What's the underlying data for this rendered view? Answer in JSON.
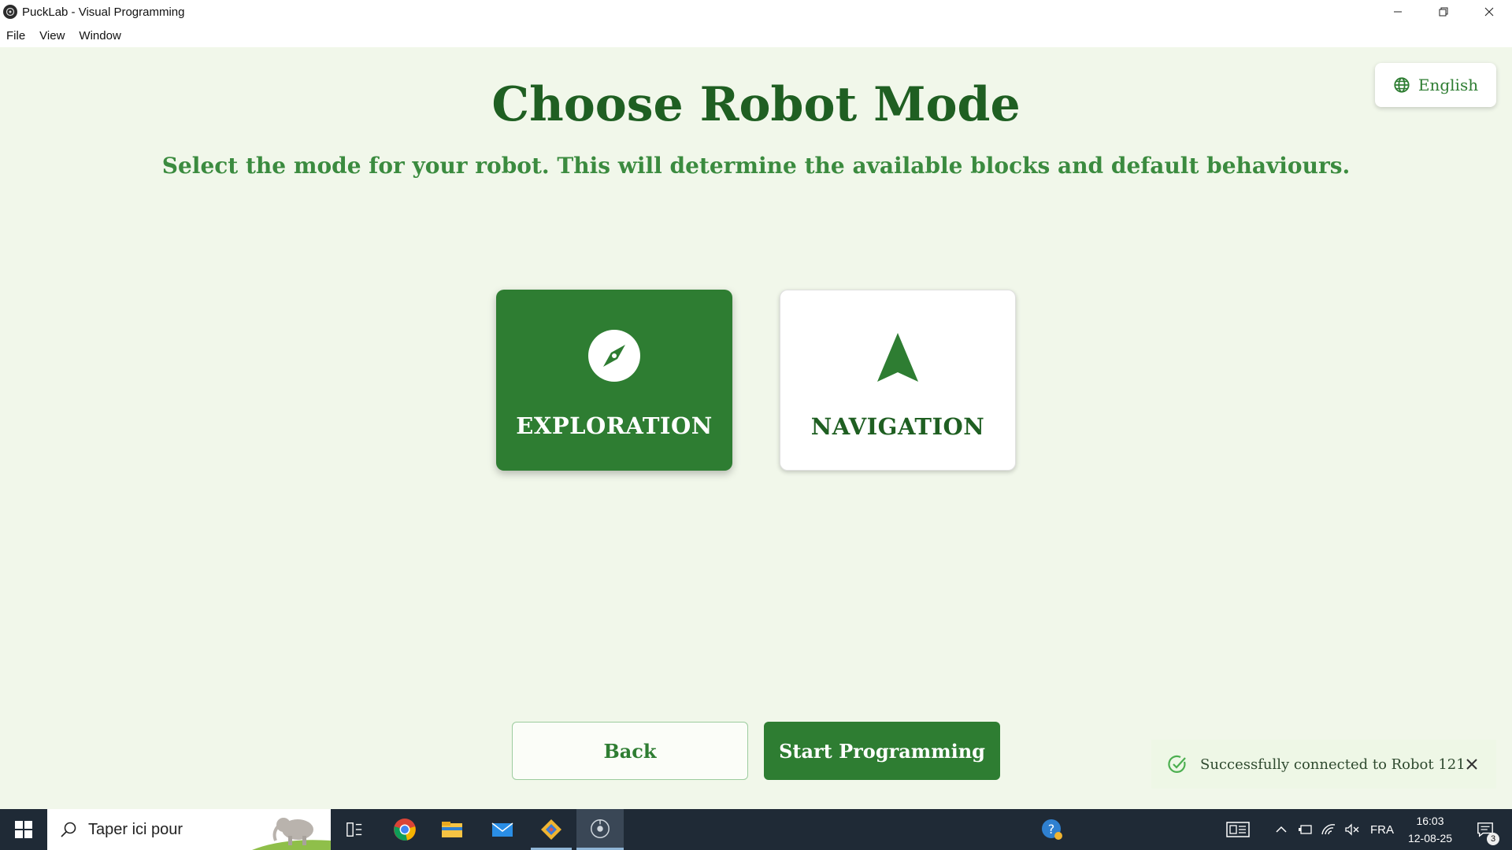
{
  "window": {
    "title": "PuckLab - Visual Programming",
    "controls": [
      "minimize-icon",
      "restore-icon",
      "close-icon"
    ]
  },
  "menu": {
    "items": [
      "File",
      "View",
      "Window"
    ]
  },
  "language": {
    "label": "English",
    "icon": "globe-icon"
  },
  "page": {
    "title": "Choose Robot Mode",
    "subtitle": "Select the mode for your robot. This will determine the available blocks and default behaviours."
  },
  "modes": [
    {
      "label": "EXPLORATION",
      "icon": "compass-icon",
      "selected": true
    },
    {
      "label": "NAVIGATION",
      "icon": "navigation-arrow-icon",
      "selected": false
    }
  ],
  "actions": {
    "back_label": "Back",
    "start_label": "Start Programming"
  },
  "toast": {
    "message": "Successfully connected to Robot 121",
    "icon": "check-circle-icon"
  },
  "taskbar": {
    "search_placeholder": "Taper ici pour",
    "language": "FRA",
    "time": "16:03",
    "date": "12-08-25",
    "notification_count": "3"
  },
  "colors": {
    "primary": "#2e7d32",
    "title": "#1f5f22",
    "subtitle": "#3b8b3f",
    "background": "#f1f7ea"
  }
}
